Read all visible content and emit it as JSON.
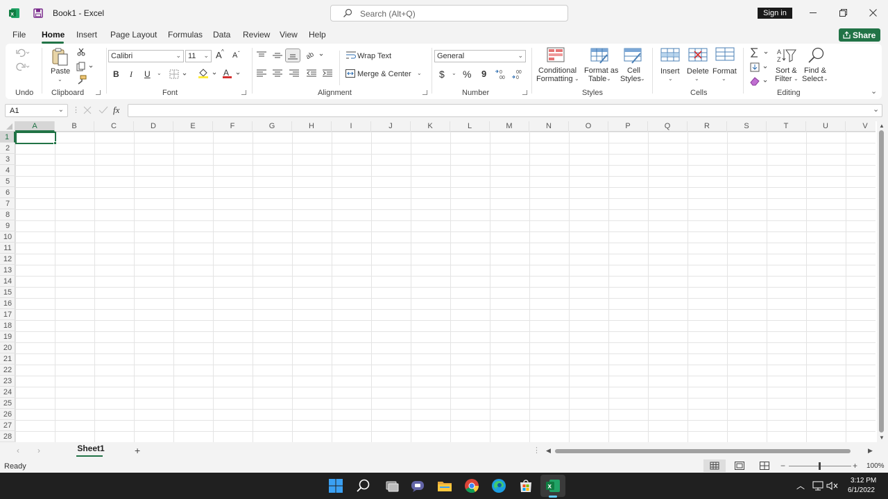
{
  "window": {
    "title": "Book1  -  Excel",
    "search_placeholder": "Search (Alt+Q)",
    "sign_in": "Sign in"
  },
  "tabs": [
    {
      "label": "File"
    },
    {
      "label": "Home"
    },
    {
      "label": "Insert"
    },
    {
      "label": "Page Layout"
    },
    {
      "label": "Formulas"
    },
    {
      "label": "Data"
    },
    {
      "label": "Review"
    },
    {
      "label": "View"
    },
    {
      "label": "Help"
    }
  ],
  "share": {
    "label": "Share"
  },
  "ribbon": {
    "undo": {
      "group": "Undo"
    },
    "clipboard": {
      "paste": "Paste",
      "group": "Clipboard"
    },
    "font": {
      "family": "Calibri",
      "size": "11",
      "group": "Font",
      "bold": "B",
      "italic": "I",
      "underline": "U",
      "grow": "A",
      "shrink": "A",
      "color": "A"
    },
    "alignment": {
      "wrap_text": "Wrap Text",
      "merge_center": "Merge & Center",
      "group": "Alignment"
    },
    "number": {
      "format": "General",
      "currency": "$",
      "percent": "%",
      "comma": "9",
      "group": "Number"
    },
    "styles": {
      "conditional_1": "Conditional",
      "conditional_2": "Formatting",
      "format_table_1": "Format as",
      "format_table_2": "Table",
      "cell_styles_1": "Cell",
      "cell_styles_2": "Styles",
      "group": "Styles"
    },
    "cells": {
      "insert": "Insert",
      "delete": "Delete",
      "format": "Format",
      "group": "Cells"
    },
    "editing": {
      "sort_1": "Sort &",
      "sort_2": "Filter",
      "find_1": "Find &",
      "find_2": "Select",
      "group": "Editing"
    }
  },
  "formula_bar": {
    "name_box": "A1",
    "fx": "fx",
    "value": ""
  },
  "grid": {
    "columns": [
      "A",
      "B",
      "C",
      "D",
      "E",
      "F",
      "G",
      "H",
      "I",
      "J",
      "K",
      "L",
      "M",
      "N",
      "O",
      "P",
      "Q",
      "R",
      "S",
      "T",
      "U",
      "V"
    ],
    "rows": [
      "1",
      "2",
      "3",
      "4",
      "5",
      "6",
      "7",
      "8",
      "9",
      "10",
      "11",
      "12",
      "13",
      "14",
      "15",
      "16",
      "17",
      "18",
      "19",
      "20",
      "21",
      "22",
      "23",
      "24",
      "25",
      "26",
      "27",
      "28"
    ],
    "selected_cell": "A1"
  },
  "sheets": {
    "tabs": [
      "Sheet1"
    ],
    "add": "+"
  },
  "status": {
    "ready": "Ready",
    "zoom": "100%"
  },
  "taskbar": {
    "time": "3:12 PM",
    "date": "6/1/2022"
  },
  "colors": {
    "accent": "#217346",
    "taskbar": "#202020"
  }
}
